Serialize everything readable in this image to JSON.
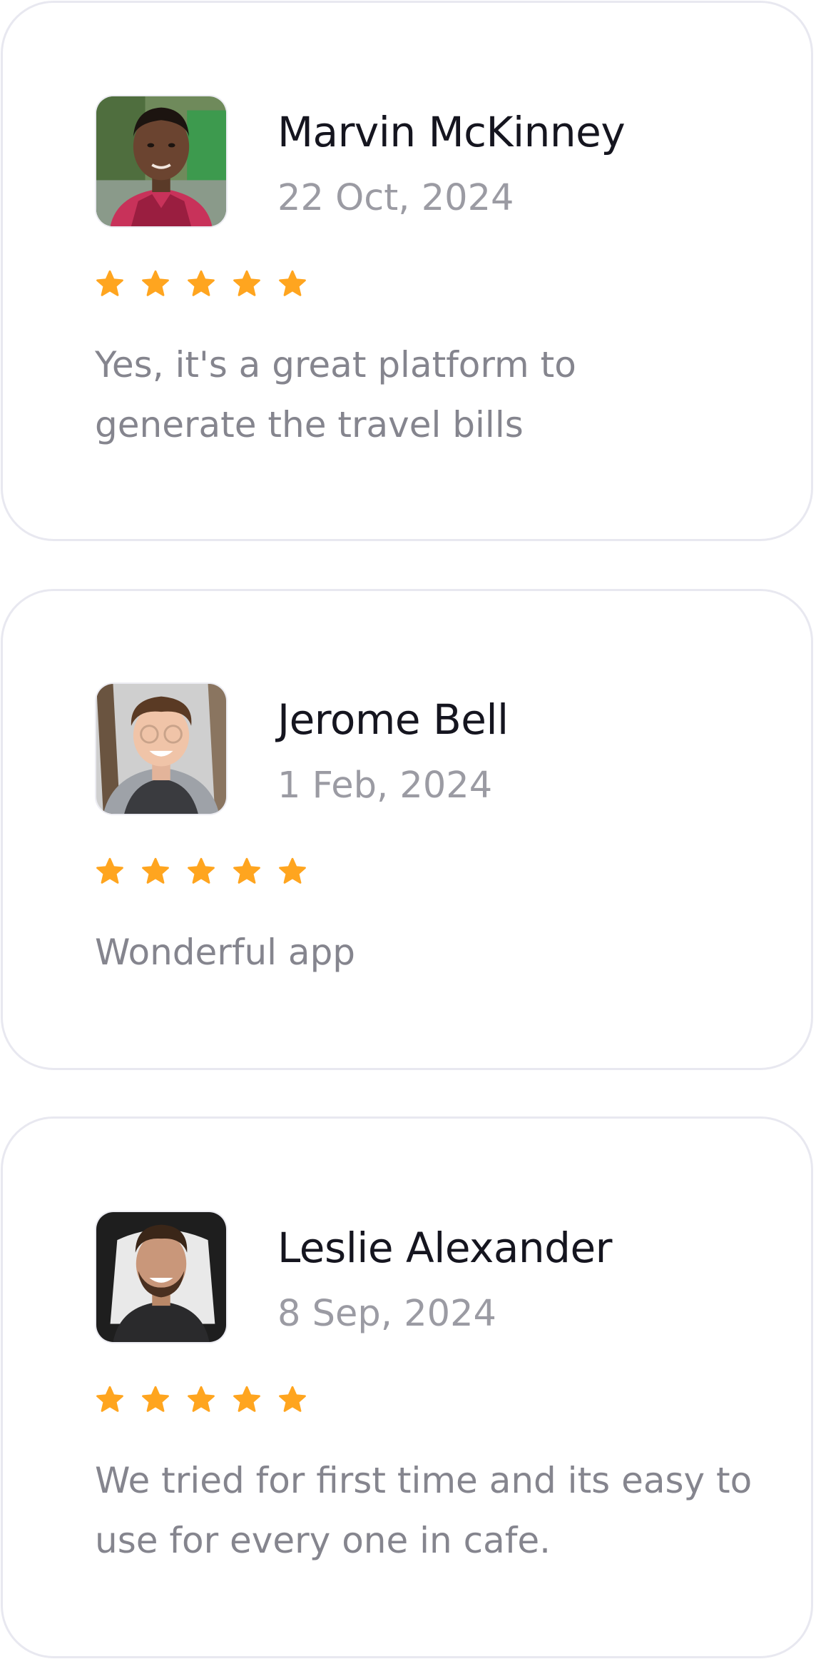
{
  "colors": {
    "star": "#ffa51f",
    "name": "#15151f",
    "muted": "#9b9ba3",
    "border": "#e8e8f0"
  },
  "reviews": [
    {
      "name": "Marvin McKinney",
      "date": "22 Oct, 2024",
      "rating": 5,
      "comment": "Yes, it's a great platform to generate the travel bills"
    },
    {
      "name": "Jerome Bell",
      "date": "1 Feb, 2024",
      "rating": 5,
      "comment": "Wonderful app"
    },
    {
      "name": "Leslie Alexander",
      "date": "8 Sep, 2024",
      "rating": 5,
      "comment": "We tried for first time and its easy to use for every one in cafe."
    }
  ]
}
